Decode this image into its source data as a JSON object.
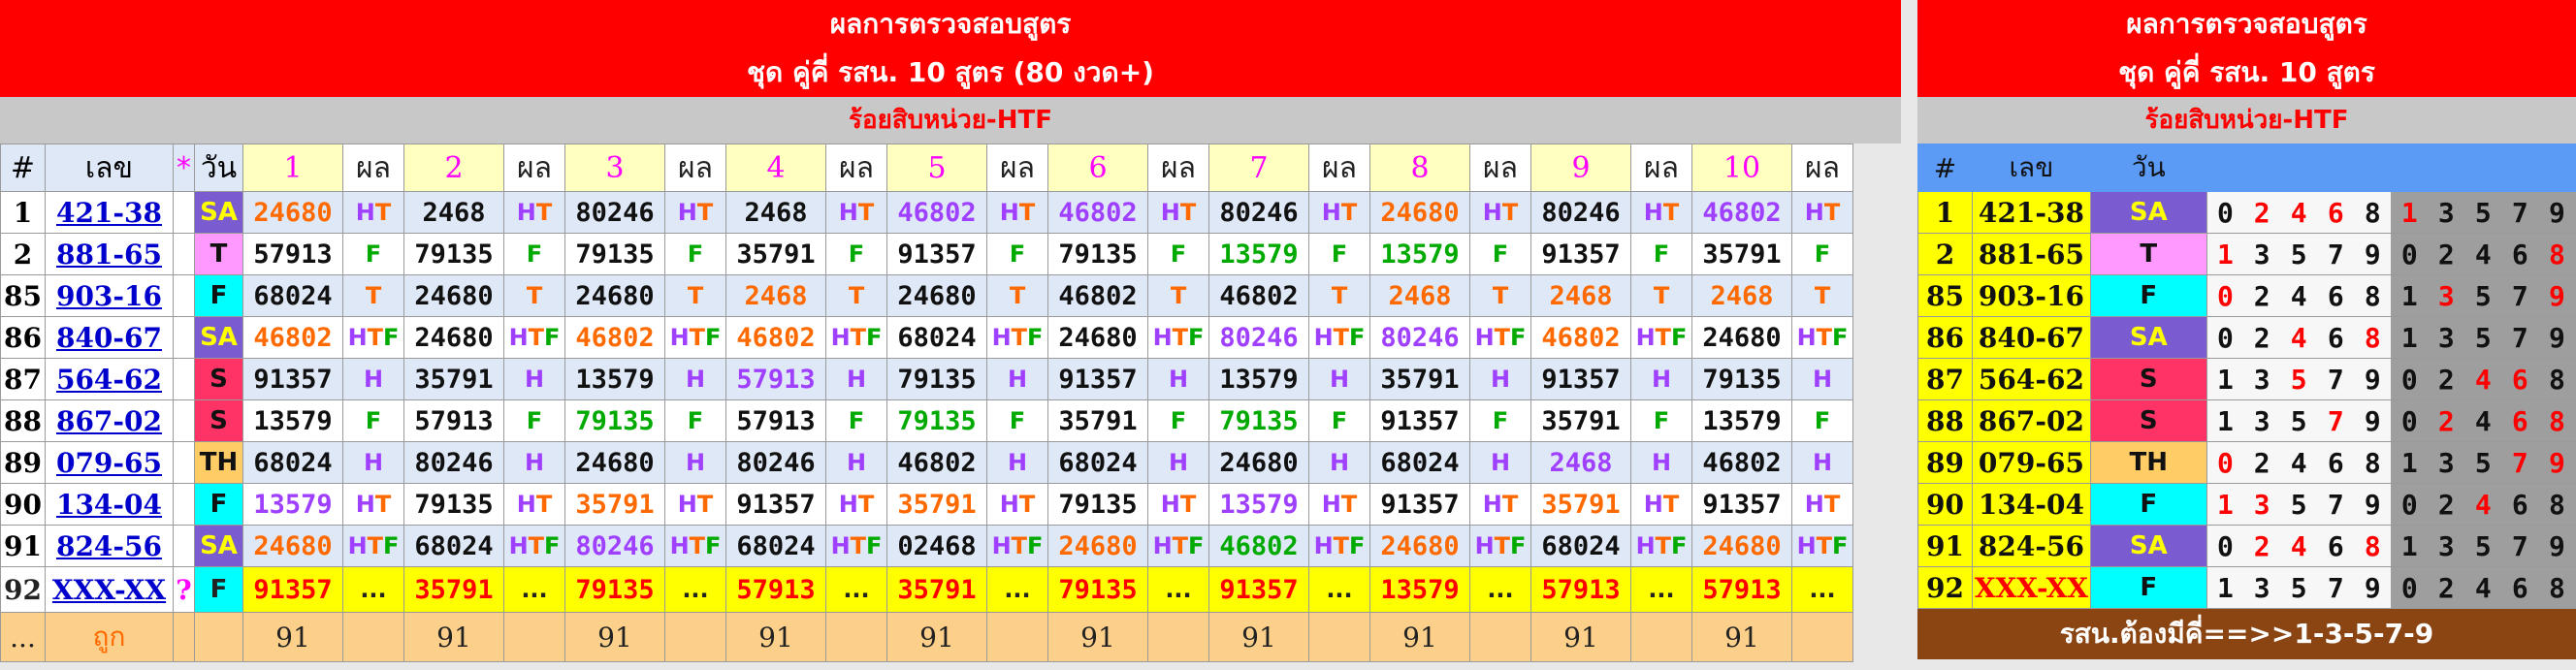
{
  "left": {
    "title1": "ผลการตรวจสอบสูตร",
    "title2": "ชุด คู่คี่ รสน. 10 สูตร (80 งวด+)",
    "subtitle": "ร้อยสิบหน่วย-HTF",
    "headers": {
      "idx": "#",
      "code": "เลข",
      "star": "*",
      "day": "วัน",
      "cols": [
        "1",
        "2",
        "3",
        "4",
        "5",
        "6",
        "7",
        "8",
        "9",
        "10"
      ],
      "res": "ผล"
    },
    "rows": [
      {
        "idx": "1",
        "code": "421-38",
        "star": "",
        "day": "SA",
        "dayc": "sa",
        "vals": [
          "24680",
          "2468",
          "80246",
          "2468",
          "46802",
          "46802",
          "80246",
          "24680",
          "80246",
          "46802"
        ],
        "valc": [
          "o",
          "b",
          "b",
          "b",
          "p",
          "p",
          "b",
          "o",
          "b",
          "p"
        ],
        "res": [
          "HT",
          "HT",
          "HT",
          "HT",
          "HT",
          "HT",
          "HT",
          "HT",
          "HT",
          "HT"
        ]
      },
      {
        "idx": "2",
        "code": "881-65",
        "star": "",
        "day": "T",
        "dayc": "t",
        "vals": [
          "57913",
          "79135",
          "79135",
          "35791",
          "91357",
          "79135",
          "13579",
          "13579",
          "91357",
          "35791"
        ],
        "valc": [
          "b",
          "b",
          "b",
          "b",
          "b",
          "b",
          "g",
          "g",
          "b",
          "b"
        ],
        "res": [
          "F",
          "F",
          "F",
          "F",
          "F",
          "F",
          "F",
          "F",
          "F",
          "F"
        ]
      },
      {
        "idx": "85",
        "code": "903-16",
        "star": "",
        "day": "F",
        "dayc": "f",
        "vals": [
          "68024",
          "24680",
          "24680",
          "2468",
          "24680",
          "46802",
          "46802",
          "2468",
          "2468",
          "2468"
        ],
        "valc": [
          "b",
          "b",
          "b",
          "o",
          "b",
          "b",
          "b",
          "o",
          "o",
          "o"
        ],
        "res": [
          "T",
          "T",
          "T",
          "T",
          "T",
          "T",
          "T",
          "T",
          "T",
          "T"
        ]
      },
      {
        "idx": "86",
        "code": "840-67",
        "star": "",
        "day": "SA",
        "dayc": "sa",
        "vals": [
          "46802",
          "24680",
          "46802",
          "46802",
          "68024",
          "24680",
          "80246",
          "80246",
          "46802",
          "24680"
        ],
        "valc": [
          "o",
          "b",
          "o",
          "o",
          "b",
          "b",
          "p",
          "p",
          "o",
          "b"
        ],
        "res": [
          "HTF",
          "HTF",
          "HTF",
          "HTF",
          "HTF",
          "HTF",
          "HTF",
          "HTF",
          "HTF",
          "HTF"
        ]
      },
      {
        "idx": "87",
        "code": "564-62",
        "star": "",
        "day": "S",
        "dayc": "s",
        "vals": [
          "91357",
          "35791",
          "13579",
          "57913",
          "79135",
          "91357",
          "13579",
          "35791",
          "91357",
          "79135"
        ],
        "valc": [
          "b",
          "b",
          "b",
          "p",
          "b",
          "b",
          "b",
          "b",
          "b",
          "b"
        ],
        "res": [
          "H",
          "H",
          "H",
          "H",
          "H",
          "H",
          "H",
          "H",
          "H",
          "H"
        ]
      },
      {
        "idx": "88",
        "code": "867-02",
        "star": "",
        "day": "S",
        "dayc": "s",
        "vals": [
          "13579",
          "57913",
          "79135",
          "57913",
          "79135",
          "35791",
          "79135",
          "91357",
          "35791",
          "13579"
        ],
        "valc": [
          "b",
          "b",
          "g",
          "b",
          "g",
          "b",
          "g",
          "b",
          "b",
          "b"
        ],
        "res": [
          "F",
          "F",
          "F",
          "F",
          "F",
          "F",
          "F",
          "F",
          "F",
          "F"
        ]
      },
      {
        "idx": "89",
        "code": "079-65",
        "star": "",
        "day": "TH",
        "dayc": "th",
        "vals": [
          "68024",
          "80246",
          "24680",
          "80246",
          "46802",
          "68024",
          "24680",
          "68024",
          "2468",
          "46802"
        ],
        "valc": [
          "b",
          "b",
          "b",
          "b",
          "b",
          "b",
          "b",
          "b",
          "p",
          "b"
        ],
        "res": [
          "H",
          "H",
          "H",
          "H",
          "H",
          "H",
          "H",
          "H",
          "H",
          "H"
        ]
      },
      {
        "idx": "90",
        "code": "134-04",
        "star": "",
        "day": "F",
        "dayc": "f",
        "vals": [
          "13579",
          "79135",
          "35791",
          "91357",
          "35791",
          "79135",
          "13579",
          "91357",
          "35791",
          "91357"
        ],
        "valc": [
          "p",
          "b",
          "o",
          "b",
          "o",
          "b",
          "p",
          "b",
          "o",
          "b"
        ],
        "res": [
          "HT",
          "HT",
          "HT",
          "HT",
          "HT",
          "HT",
          "HT",
          "HT",
          "HT",
          "HT"
        ]
      },
      {
        "idx": "91",
        "code": "824-56",
        "star": "",
        "day": "SA",
        "dayc": "sa",
        "vals": [
          "24680",
          "68024",
          "80246",
          "68024",
          "02468",
          "24680",
          "46802",
          "24680",
          "68024",
          "24680"
        ],
        "valc": [
          "o",
          "b",
          "p",
          "b",
          "b",
          "o",
          "g",
          "o",
          "b",
          "o"
        ],
        "res": [
          "HTF",
          "HTF",
          "HTF",
          "HTF",
          "HTF",
          "HTF",
          "HTF",
          "HTF",
          "HTF",
          "HTF"
        ]
      }
    ],
    "pred": {
      "idx": "92",
      "code": "XXX-XX",
      "star": "?",
      "day": "F",
      "vals": [
        "91357",
        "35791",
        "79135",
        "57913",
        "35791",
        "79135",
        "91357",
        "13579",
        "57913",
        "57913"
      ],
      "res": "..."
    },
    "total": {
      "idx": "...",
      "label": "ถูก",
      "vals": [
        "91",
        "91",
        "91",
        "91",
        "91",
        "91",
        "91",
        "91",
        "91",
        "91"
      ]
    }
  },
  "right": {
    "title1": "ผลการตรวจสอบสูตร",
    "title2": "ชุด คู่คี่ รสน. 10 สูตร",
    "subtitle": "ร้อยสิบหน่วย-HTF",
    "headers": {
      "idx": "#",
      "code": "เลข",
      "day": "วัน"
    },
    "rows": [
      {
        "idx": "1",
        "code": "421-38",
        "day": "SA",
        "dayc": "sa",
        "g1": [
          "0",
          "2",
          "4",
          "6",
          "8"
        ],
        "g2": [
          "1",
          "3",
          "5",
          "7",
          "9"
        ],
        "h1": [
          1,
          2,
          3
        ],
        "h2": [
          0
        ]
      },
      {
        "idx": "2",
        "code": "881-65",
        "day": "T",
        "dayc": "t",
        "g1": [
          "1",
          "3",
          "5",
          "7",
          "9"
        ],
        "g2": [
          "0",
          "2",
          "4",
          "6",
          "8"
        ],
        "h1": [
          0
        ],
        "h2": [
          4
        ]
      },
      {
        "idx": "85",
        "code": "903-16",
        "day": "F",
        "dayc": "f",
        "g1": [
          "0",
          "2",
          "4",
          "6",
          "8"
        ],
        "g2": [
          "1",
          "3",
          "5",
          "7",
          "9"
        ],
        "h1": [
          0
        ],
        "h2": [
          1,
          4
        ]
      },
      {
        "idx": "86",
        "code": "840-67",
        "day": "SA",
        "dayc": "sa",
        "g1": [
          "0",
          "2",
          "4",
          "6",
          "8"
        ],
        "g2": [
          "1",
          "3",
          "5",
          "7",
          "9"
        ],
        "h1": [
          2,
          4
        ],
        "h2": []
      },
      {
        "idx": "87",
        "code": "564-62",
        "day": "S",
        "dayc": "s",
        "g1": [
          "1",
          "3",
          "5",
          "7",
          "9"
        ],
        "g2": [
          "0",
          "2",
          "4",
          "6",
          "8"
        ],
        "h1": [
          2
        ],
        "h2": [
          2,
          3
        ]
      },
      {
        "idx": "88",
        "code": "867-02",
        "day": "S",
        "dayc": "s",
        "g1": [
          "1",
          "3",
          "5",
          "7",
          "9"
        ],
        "g2": [
          "0",
          "2",
          "4",
          "6",
          "8"
        ],
        "h1": [
          3
        ],
        "h2": [
          1,
          3,
          4
        ]
      },
      {
        "idx": "89",
        "code": "079-65",
        "day": "TH",
        "dayc": "th",
        "g1": [
          "0",
          "2",
          "4",
          "6",
          "8"
        ],
        "g2": [
          "1",
          "3",
          "5",
          "7",
          "9"
        ],
        "h1": [
          0
        ],
        "h2": [
          3,
          4
        ]
      },
      {
        "idx": "90",
        "code": "134-04",
        "day": "F",
        "dayc": "f",
        "g1": [
          "1",
          "3",
          "5",
          "7",
          "9"
        ],
        "g2": [
          "0",
          "2",
          "4",
          "6",
          "8"
        ],
        "h1": [
          0,
          1
        ],
        "h2": [
          2
        ]
      },
      {
        "idx": "91",
        "code": "824-56",
        "day": "SA",
        "dayc": "sa",
        "g1": [
          "0",
          "2",
          "4",
          "6",
          "8"
        ],
        "g2": [
          "1",
          "3",
          "5",
          "7",
          "9"
        ],
        "h1": [
          1,
          2,
          4
        ],
        "h2": []
      }
    ],
    "pred": {
      "idx": "92",
      "code": "XXX-XX",
      "day": "F",
      "g1": [
        "1",
        "3",
        "5",
        "7",
        "9"
      ],
      "g2": [
        "0",
        "2",
        "4",
        "6",
        "8"
      ]
    },
    "footer": "รสน.ต้องมีคี่==>>1-3-5-7-9"
  }
}
